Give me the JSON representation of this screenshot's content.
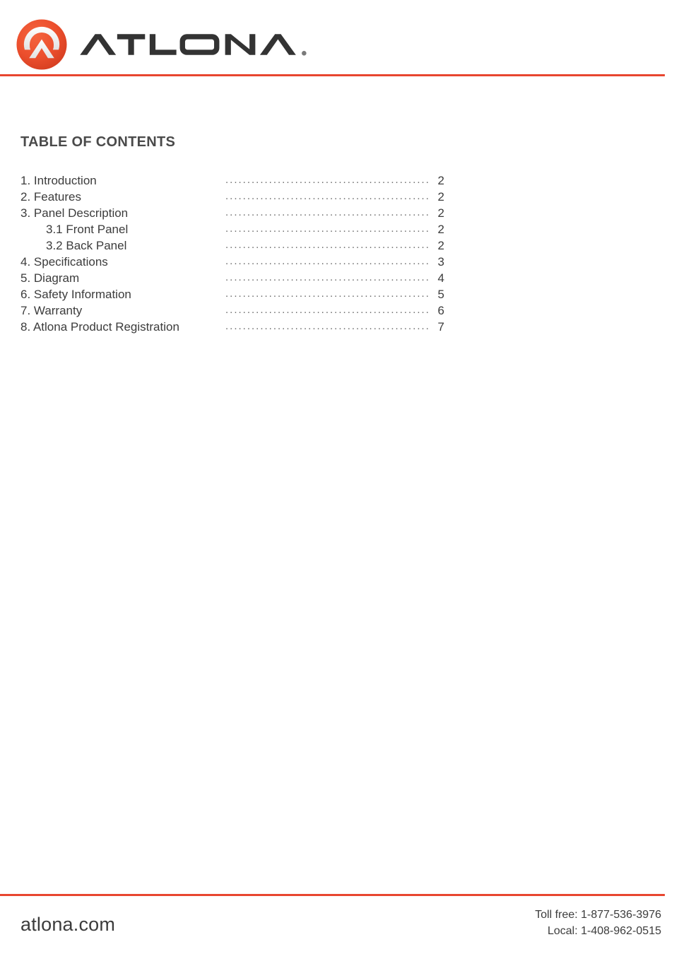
{
  "header": {
    "logo_icon": "atlona-circle-chevron-logo",
    "wordmark_text": "ATLONA",
    "registered_mark": "®",
    "accent_color": "#e8462f",
    "logo_orange": "#e8462f",
    "wordmark_color": "#333333"
  },
  "main": {
    "toc_heading": "TABLE OF CONTENTS",
    "leader_dots": "..................................................................................................",
    "entries": [
      {
        "label": "1. Introduction",
        "page": "2",
        "level": 1
      },
      {
        "label": "2. Features",
        "page": "2",
        "level": 1
      },
      {
        "label": "3. Panel Description",
        "page": "2",
        "level": 1
      },
      {
        "label": "3.1 Front Panel",
        "page": "2",
        "level": 2
      },
      {
        "label": "3.2 Back Panel",
        "page": "2",
        "level": 2
      },
      {
        "label": "4. Specifications",
        "page": "3",
        "level": 1
      },
      {
        "label": "5. Diagram",
        "page": "4",
        "level": 1
      },
      {
        "label": "6. Safety Information",
        "page": "5",
        "level": 1
      },
      {
        "label": "7. Warranty",
        "page": "6",
        "level": 1
      },
      {
        "label": "8. Atlona Product Registration",
        "page": "7",
        "level": 1
      }
    ]
  },
  "footer": {
    "website": "atlona.com",
    "toll_free": "Toll free: 1-877-536-3976",
    "local": "Local: 1-408-962-0515"
  }
}
